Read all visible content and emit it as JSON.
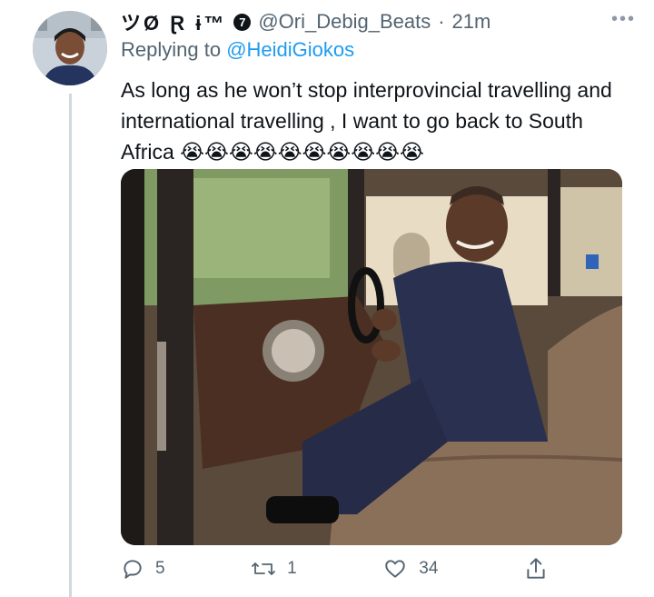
{
  "user": {
    "display_name": "ツØ Ɽ ɨ™",
    "badge": "7",
    "handle": "@Ori_Debig_Beats",
    "separator": "·",
    "time": "21m"
  },
  "reply": {
    "prefix": "Replying to",
    "target": "@HeidiGiokos"
  },
  "tweet": {
    "text": "As long as he won’t stop interprovincial travelling and international travelling , I want to go back to South Africa 😭😭😭😭😭😭😭😭😭😭"
  },
  "actions": {
    "reply_count": "5",
    "retweet_count": "1",
    "like_count": "34"
  },
  "icons": {
    "reply": "speech-bubble-icon",
    "retweet": "retweet-icon",
    "like": "heart-icon",
    "share": "share-icon",
    "more": "more-dots-icon"
  },
  "colors": {
    "text": "#0f1419",
    "secondary": "#536471",
    "link": "#1d9bf0",
    "thread_line": "#cfd9de"
  }
}
